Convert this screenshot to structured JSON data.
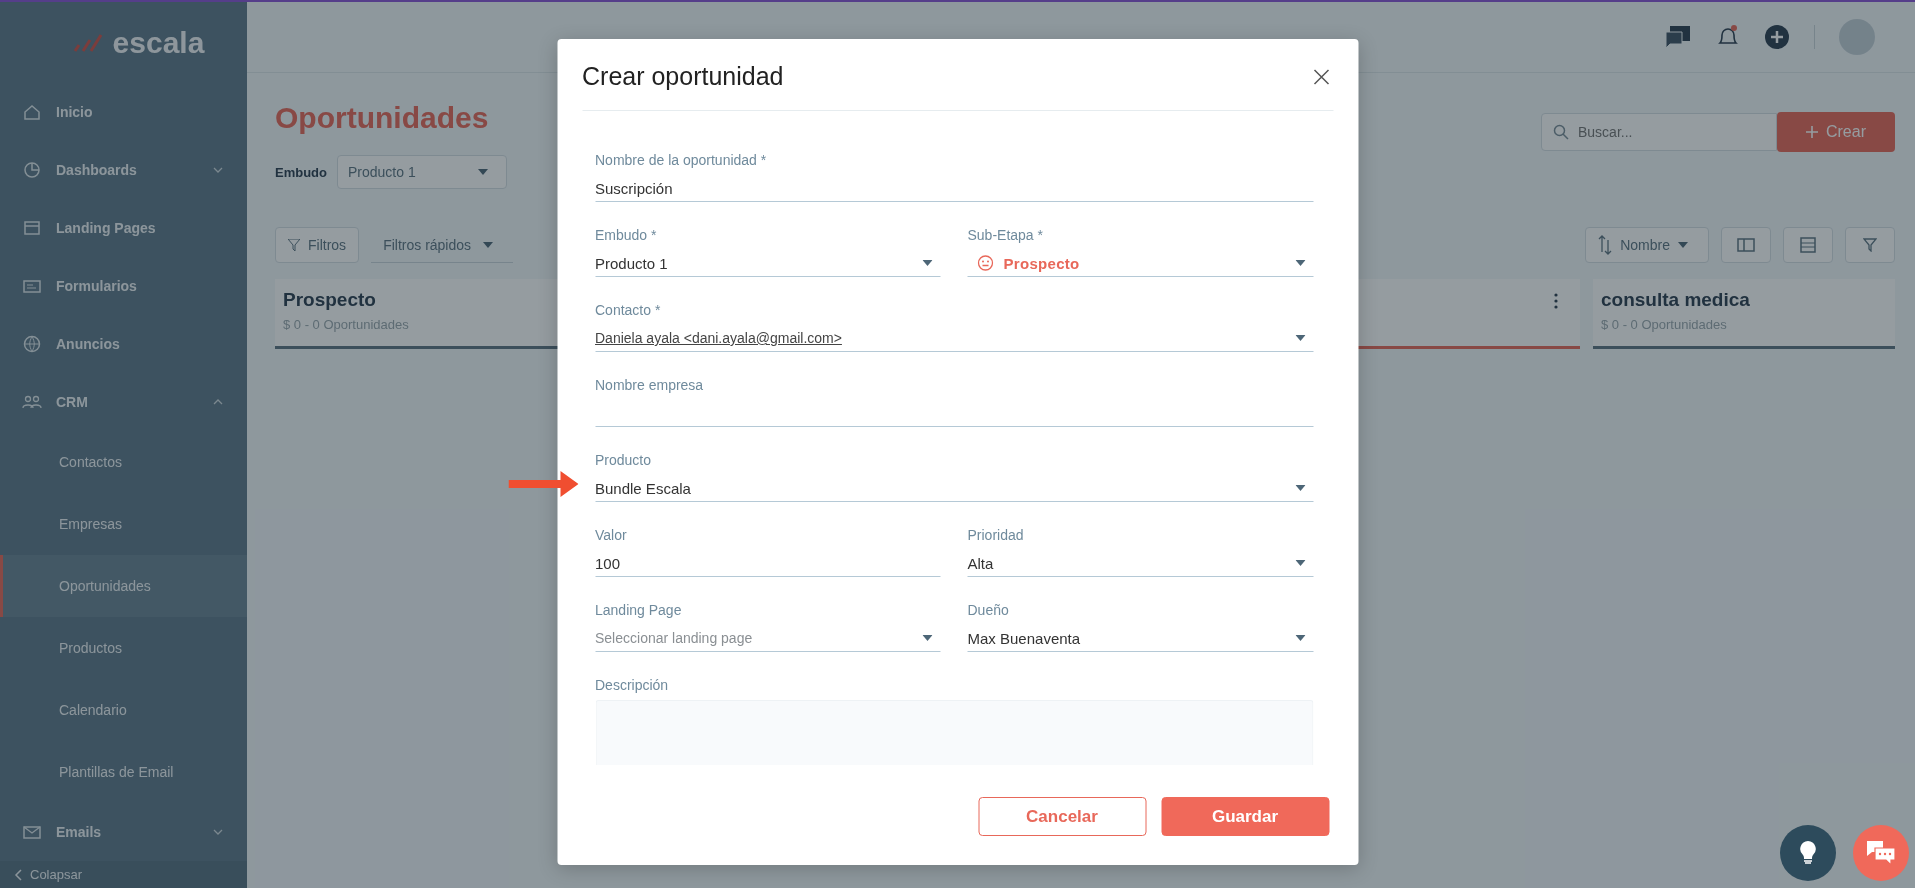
{
  "sidebar": {
    "logo": "escala",
    "items": [
      {
        "kind": "link",
        "label": "Inicio"
      },
      {
        "kind": "group",
        "label": "Dashboards",
        "expanded": false
      },
      {
        "kind": "link",
        "label": "Landing Pages"
      },
      {
        "kind": "link",
        "label": "Formularios"
      },
      {
        "kind": "link",
        "label": "Anuncios"
      },
      {
        "kind": "group",
        "label": "CRM",
        "expanded": true,
        "children": [
          {
            "label": "Contactos",
            "selected": false
          },
          {
            "label": "Empresas",
            "selected": false
          },
          {
            "label": "Oportunidades",
            "selected": true
          },
          {
            "label": "Productos",
            "selected": false
          },
          {
            "label": "Calendario",
            "selected": false
          },
          {
            "label": "Plantillas de Email",
            "selected": false
          }
        ]
      },
      {
        "kind": "group",
        "label": "Emails",
        "expanded": false
      }
    ],
    "collapse": "Colapsar"
  },
  "page": {
    "title": "Oportunidades",
    "funnel_label": "Embudo",
    "funnel_value": "Producto 1",
    "search": {
      "placeholder": "Buscar..."
    },
    "create_button": "Crear",
    "filters_button": "Filtros",
    "quick_filters": "Filtros rápidos",
    "sort": "Nombre",
    "columns": [
      {
        "name": "Prospecto",
        "summary": "$ 0 - 0 Oportunidades",
        "selected": false
      },
      {
        "selected": true
      },
      {
        "name": "consulta medica",
        "summary": "$ 0 - 0 Oportunidades",
        "selected": false
      }
    ]
  },
  "modal": {
    "title": "Crear oportunidad",
    "rows": [
      {
        "pointed": false,
        "fields": [
          {
            "kind": "text",
            "label": "Nombre de la oportunidad *",
            "value": "Suscripción"
          }
        ]
      },
      {
        "pointed": false,
        "fields": [
          {
            "kind": "select",
            "label": "Embudo *",
            "value": "Producto 1"
          },
          {
            "kind": "stage",
            "label": "Sub-Etapa *",
            "value": "Prospecto"
          }
        ]
      },
      {
        "pointed": false,
        "fields": [
          {
            "kind": "link-select",
            "label": "Contacto *",
            "value": "Daniela ayala <dani.ayala@gmail.com>"
          }
        ]
      },
      {
        "pointed": false,
        "fields": [
          {
            "kind": "text",
            "label": "Nombre empresa"
          }
        ]
      },
      {
        "pointed": true,
        "fields": [
          {
            "kind": "select",
            "label": "Producto",
            "value": "Bundle Escala"
          }
        ]
      },
      {
        "pointed": false,
        "fields": [
          {
            "kind": "text",
            "label": "Valor",
            "value": "100"
          },
          {
            "kind": "select",
            "label": "Prioridad",
            "value": "Alta"
          }
        ]
      },
      {
        "pointed": false,
        "fields": [
          {
            "kind": "select",
            "label": "Landing Page",
            "placeholder": "Seleccionar landing page"
          },
          {
            "kind": "select",
            "label": "Dueño",
            "value": "Max Buenaventa"
          }
        ]
      },
      {
        "pointed": false,
        "fields": [
          {
            "kind": "textarea",
            "label": "Descripción"
          }
        ]
      }
    ],
    "buttons": [
      {
        "kind": "secondary",
        "label": "Cancelar"
      },
      {
        "kind": "primary",
        "label": "Guardar"
      }
    ]
  }
}
